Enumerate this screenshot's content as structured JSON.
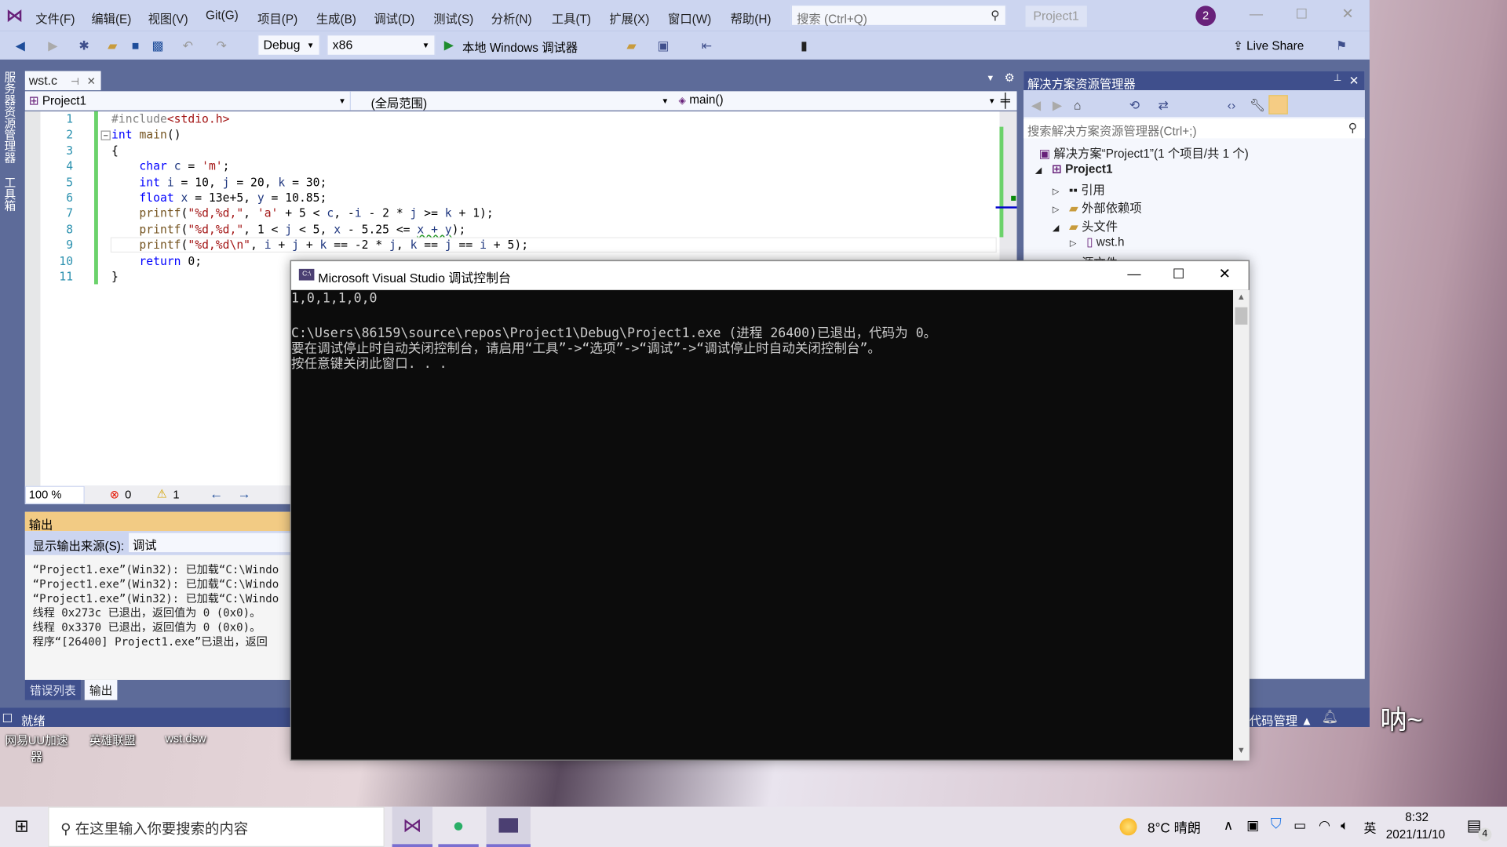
{
  "menubar": {
    "items": [
      "文件(F)",
      "编辑(E)",
      "视图(V)",
      "Git(G)",
      "项目(P)",
      "生成(B)",
      "调试(D)",
      "测试(S)",
      "分析(N)",
      "工具(T)",
      "扩展(X)",
      "窗口(W)",
      "帮助(H)"
    ],
    "search_placeholder": "搜索 (Ctrl+Q)",
    "solution_name": "Project1",
    "notification_count": "2"
  },
  "toolbar": {
    "config": "Debug",
    "platform": "x86",
    "run_label": "本地 Windows 调试器",
    "live_share": "Live Share"
  },
  "side_tabs": [
    "服务器资源管理器",
    "工具箱"
  ],
  "editor": {
    "tab": "wst.c",
    "nav_project": "Project1",
    "nav_scope": "(全局范围)",
    "nav_member": "main()",
    "line_numbers": [
      "1",
      "2",
      "3",
      "4",
      "5",
      "6",
      "7",
      "8",
      "9",
      "10",
      "11"
    ],
    "zoom": "100 %",
    "errors": "0",
    "warnings": "1"
  },
  "output": {
    "title": "输出",
    "source_label": "显示输出来源(S):",
    "source_value": "调试",
    "lines": [
      "“Project1.exe”(Win32): 已加载“C:\\Windo",
      "“Project1.exe”(Win32): 已加载“C:\\Windo",
      "“Project1.exe”(Win32): 已加载“C:\\Windo",
      "线程 0x273c 已退出，返回值为 0 (0x0)。",
      "线程 0x3370 已退出，返回值为 0 (0x0)。",
      "程序“[26400] Project1.exe”已退出，返回"
    ],
    "tabs": [
      "错误列表",
      "输出"
    ]
  },
  "statusbar": {
    "status": "就绪",
    "source_control": "代码管理"
  },
  "solution_explorer": {
    "title": "解决方案资源管理器",
    "search_placeholder": "搜索解决方案资源管理器(Ctrl+;)",
    "solution": "解决方案“Project1”(1 个项目/共 1 个)",
    "project": "Project1",
    "items": [
      "引用",
      "外部依赖项",
      "头文件",
      "wst.h",
      "源文件"
    ]
  },
  "console": {
    "title": "Microsoft Visual Studio 调试控制台",
    "lines": [
      "1,0,1,1,0,0",
      "",
      "C:\\Users\\86159\\source\\repos\\Project1\\Debug\\Project1.exe (进程 26400)已退出，代码为 0。",
      "要在调试停止时自动关闭控制台，请启用“工具”->“选项”->“调试”->“调试停止时自动关闭控制台”。",
      "按任意键关闭此窗口. . ."
    ]
  },
  "desktop": {
    "icons": [
      "网易UU加速器",
      "英雄联盟",
      "wst.dsw"
    ],
    "wallpaper_text": "呐~"
  },
  "taskbar": {
    "search_placeholder": "在这里输入你要搜索的内容",
    "weather": "8°C 晴朗",
    "ime": "英",
    "time": "8:32",
    "date": "2021/11/10",
    "notification_badge": "4"
  },
  "colors": {
    "vs_chrome": "#ccd5f0",
    "vs_frame": "#5d6b99",
    "status_bar": "#3f4f8c",
    "output_header": "#f2cb84",
    "console_bg": "#0c0c0c"
  }
}
